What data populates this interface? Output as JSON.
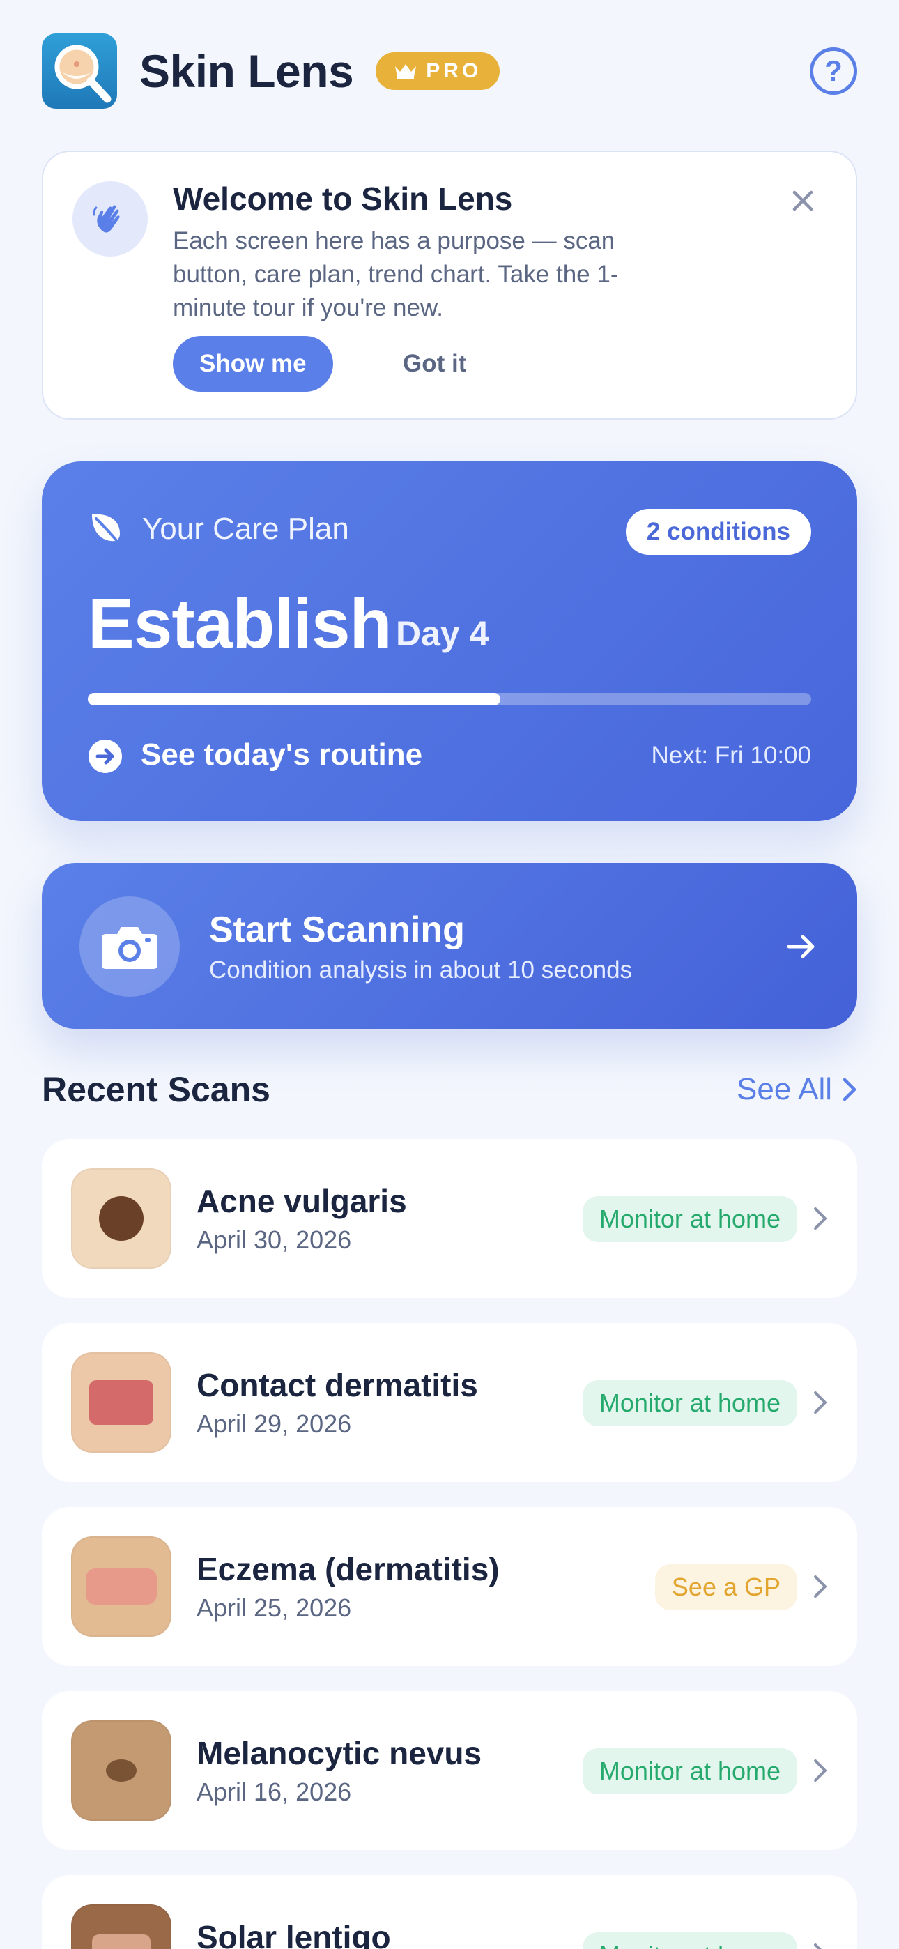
{
  "header": {
    "title": "Skin Lens",
    "pro_label": "PRO",
    "help_label": "?"
  },
  "welcome": {
    "title": "Welcome to Skin Lens",
    "body": "Each screen here has a purpose — scan button, care plan, trend chart. Take the 1-minute tour if you're new.",
    "primary_label": "Show me",
    "secondary_label": "Got it"
  },
  "care_plan": {
    "label": "Your Care Plan",
    "conditions": "2 conditions",
    "phase": "Establish",
    "day": "Day 4",
    "progress": 0.57,
    "routine_label": "See today's routine",
    "next": "Next: Fri 10:00"
  },
  "scan": {
    "title": "Start Scanning",
    "subtitle": "Condition analysis in about 10 seconds"
  },
  "recent": {
    "title": "Recent Scans",
    "see_all": "See All",
    "items": [
      {
        "name": "Acne vulgaris",
        "date": "April 30, 2026",
        "status": "Monitor at home",
        "status_tone": "green"
      },
      {
        "name": "Contact dermatitis",
        "date": "April 29, 2026",
        "status": "Monitor at home",
        "status_tone": "green"
      },
      {
        "name": "Eczema (dermatitis)",
        "date": "April 25, 2026",
        "status": "See a GP",
        "status_tone": "amber"
      },
      {
        "name": "Melanocytic nevus",
        "date": "April 16, 2026",
        "status": "Monitor at home",
        "status_tone": "green"
      },
      {
        "name": "Solar lentigo",
        "date": "",
        "status": "Monitor at home",
        "status_tone": "green"
      }
    ]
  },
  "colors": {
    "accent": "#5b7fe8",
    "background": "#f3f6fc",
    "pro_gold": "#e8b23a",
    "status_green": "#26a96c",
    "status_amber": "#e2a52f"
  },
  "icons": [
    "app-logo-icon",
    "crown-icon",
    "help-icon",
    "waving-hand-icon",
    "close-icon",
    "leaf-icon",
    "arrow-circle-right-icon",
    "camera-icon",
    "arrow-right-icon",
    "chevron-right-icon"
  ]
}
